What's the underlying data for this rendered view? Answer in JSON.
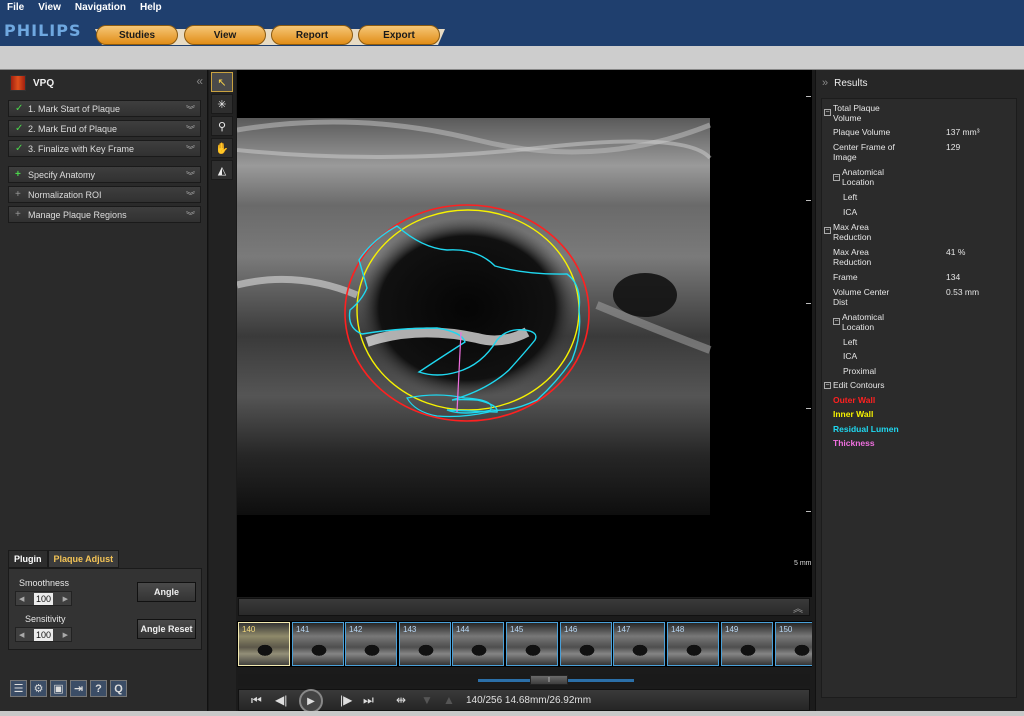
{
  "menu": [
    "File",
    "View",
    "Navigation",
    "Help"
  ],
  "brand": "PHILIPS",
  "nav_buttons": [
    "Studies",
    "View",
    "Report",
    "Export"
  ],
  "plugin": {
    "title": "VPQ",
    "steps": [
      {
        "label": "1. Mark Start of Plaque",
        "state": "done"
      },
      {
        "label": "2. Mark End of Plaque",
        "state": "done"
      },
      {
        "label": "3. Finalize with Key Frame",
        "state": "done"
      }
    ],
    "sections": [
      {
        "label": "Specify Anatomy",
        "state": "active"
      },
      {
        "label": "Normalization ROI",
        "state": "inactive"
      },
      {
        "label": "Manage Plaque Regions",
        "state": "inactive"
      }
    ]
  },
  "tabs": {
    "plugin": "Plugin",
    "plaque_adjust": "Plaque Adjust"
  },
  "adjust": {
    "smoothness_label": "Smoothness",
    "smoothness_value": "100",
    "sensitivity_label": "Sensitivity",
    "sensitivity_value": "100",
    "angle_button": "Angle",
    "angle_reset_button": "Angle Reset"
  },
  "viewport": {
    "scale_label": "5 mm"
  },
  "filmstrip": {
    "frames": [
      "140",
      "141",
      "142",
      "143",
      "144",
      "145",
      "146",
      "147",
      "148",
      "149",
      "150"
    ],
    "current_frame": "140"
  },
  "playback": {
    "status": "140/256  14.68mm/26.92mm"
  },
  "results": {
    "title": "Results",
    "total_plaque_volume": "Total Plaque Volume",
    "plaque_volume_label": "Plaque Volume",
    "plaque_volume_value": "137 mm³",
    "center_frame_label": "Center Frame of Image",
    "center_frame_value": "129",
    "anatomical_location": "Anatomical Location",
    "side_1": "Left",
    "artery_1": "ICA",
    "max_area_reduction": "Max Area Reduction",
    "max_area_label": "Max Area Reduction",
    "max_area_value": "41 %",
    "frame_label": "Frame",
    "frame_value": "134",
    "volume_center_label": "Volume Center Dist",
    "volume_center_value": "0.53 mm",
    "anatomical_location_2": "Anatomical Location",
    "side_2": "Left",
    "artery_2": "ICA",
    "position_2": "Proximal",
    "edit_contours": "Edit Contours",
    "contours": {
      "outer_wall": "Outer Wall",
      "inner_wall": "Inner Wall",
      "residual_lumen": "Residual Lumen",
      "thickness": "Thickness"
    }
  },
  "colors": {
    "outer_wall": "#ff2020",
    "inner_wall": "#f7f200",
    "residual_lumen": "#1fd8f0",
    "thickness": "#f070e0",
    "accent": "#f4c456",
    "brand_blue": "#1f3f6e"
  }
}
